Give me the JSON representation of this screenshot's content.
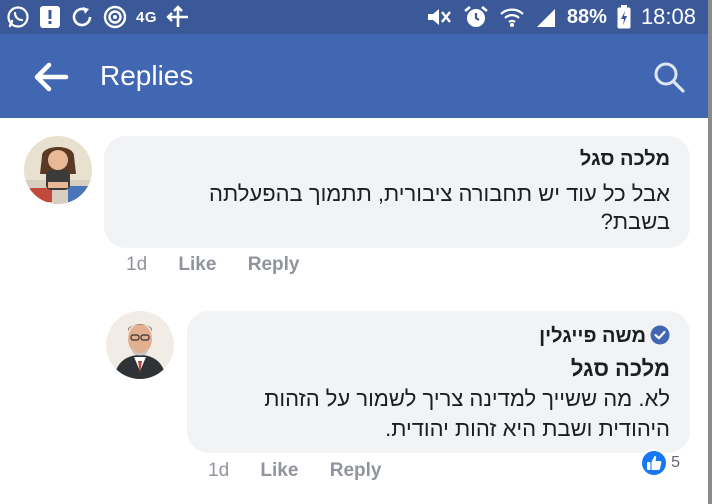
{
  "status_bar": {
    "network": "4G",
    "battery": "88%",
    "time": "18:08",
    "icons_left": [
      "whatsapp-icon",
      "alert-icon",
      "sync-icon",
      "hotspot-icon",
      "network-type",
      "transfer-icon"
    ],
    "icons_right": [
      "mute-icon",
      "alarm-icon",
      "wifi-icon",
      "signal-icon",
      "battery-icon"
    ]
  },
  "app_bar": {
    "title": "Replies",
    "background": "#4267b2",
    "icons": [
      "back-arrow-icon",
      "search-icon"
    ]
  },
  "comments": [
    {
      "author": "מלכה סגל",
      "text_lines": [
        "אבל כל עוד יש תחבורה ציבורית, תתמוך בהפעלתה",
        "בשבת?"
      ],
      "time": "1d",
      "like_label": "Like",
      "reply_label": "Reply"
    },
    {
      "author": "משה פייגלין",
      "verified": true,
      "mention": "מלכה סגל",
      "text_lines": [
        "לא. מה ששייך למדינה צריך לשמור על הזהות",
        "היהודית ושבת היא זהות יהודית."
      ],
      "time": "1d",
      "like_label": "Like",
      "reply_label": "Reply",
      "reaction_count": "5",
      "reaction_icon": "thumbs-up-icon"
    }
  ],
  "colors": {
    "status_bar": "#3b5998",
    "app_bar": "#4267b2",
    "bubble": "#f2f3f5",
    "meta_text": "#90949c",
    "like_blue": "#1877f2"
  }
}
